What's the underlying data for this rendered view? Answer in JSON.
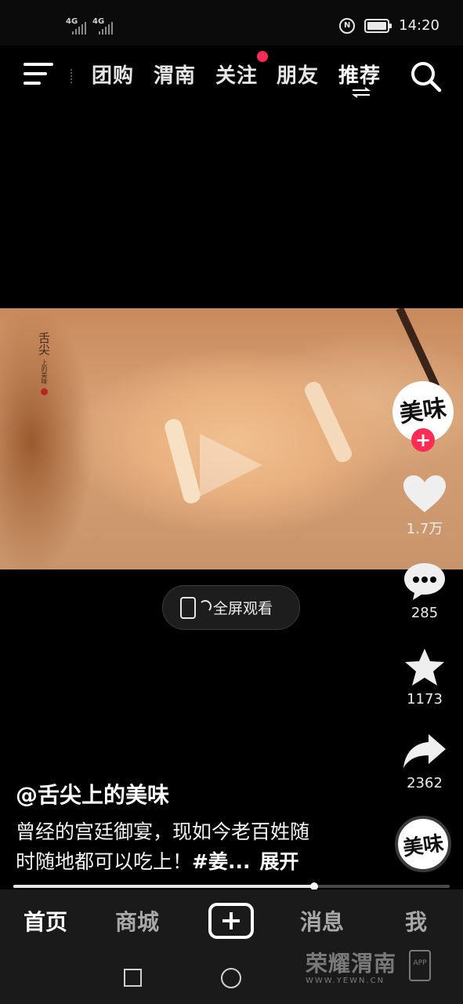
{
  "status_bar": {
    "network_1": "4G",
    "network_2": "4G",
    "nfc_icon": "nfc-icon",
    "time": "14:20"
  },
  "top_nav": {
    "tabs": [
      {
        "label": "团购"
      },
      {
        "label": "渭南"
      },
      {
        "label": "关注"
      },
      {
        "label": "朋友"
      },
      {
        "label": "推荐"
      }
    ],
    "active_tab": "推荐",
    "notification_color": "#fe2c55"
  },
  "video": {
    "watermark_main": "舌尖",
    "watermark_sub": "上的美味"
  },
  "fullscreen": {
    "label": "全屏观看"
  },
  "actions": {
    "likes": "1.7万",
    "comments": "285",
    "favorites": "1173",
    "shares": "2362"
  },
  "avatar": {
    "logo_text": "美味"
  },
  "caption": {
    "author": "@舌尖上的美味",
    "line1": "曾经的宫廷御宴，现如今老百姓随",
    "line2": "时随地都可以吃上！",
    "hashtag": "#姜...",
    "expand": "展开"
  },
  "progress": {
    "fraction": 0.69
  },
  "tab_bar": {
    "items": [
      {
        "label": "首页"
      },
      {
        "label": "商城"
      },
      {
        "label": "消息"
      },
      {
        "label": "我"
      }
    ],
    "active": "首页"
  },
  "watermark": {
    "site_name": "荣耀渭南",
    "site_url": "WWW.YEWN.CN",
    "app_label": "APP"
  }
}
